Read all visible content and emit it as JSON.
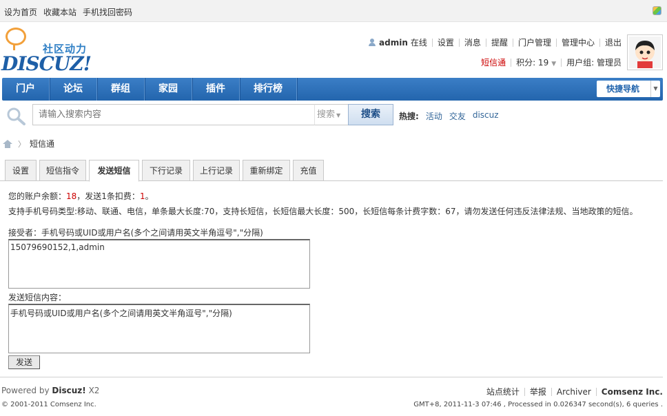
{
  "topbar": {
    "links": [
      "设为首页",
      "收藏本站",
      "手机找回密码"
    ]
  },
  "logo": {
    "cn": "社区动力",
    "en": "DISCUZ!"
  },
  "usernav": {
    "username": "admin",
    "status": "在线",
    "links": [
      "设置",
      "消息",
      "提醒",
      "门户管理",
      "管理中心",
      "退出"
    ]
  },
  "userstat": {
    "sms": "短信通",
    "points_label": "积分: 19",
    "group": "用户组: 管理员"
  },
  "mainnav": {
    "items": [
      "门户",
      "论坛",
      "群组",
      "家园",
      "插件",
      "排行榜"
    ],
    "quicknav": "快捷导航"
  },
  "search": {
    "placeholder": "请输入搜索内容",
    "type": "搜索",
    "button": "搜索",
    "hot_label": "热搜:",
    "hot_words": [
      "活动",
      "交友",
      "discuz"
    ]
  },
  "breadcrumb": {
    "current": "短信通"
  },
  "tabs": [
    "设置",
    "短信指令",
    "发送短信",
    "下行记录",
    "上行记录",
    "重新绑定",
    "充值"
  ],
  "active_tab": "发送短信",
  "info": {
    "balance_prefix": "您的账户余额：",
    "balance": "18",
    "cost_prefix": "，发送1条扣费：",
    "cost": "1",
    "cost_suffix": "。",
    "support": "支持手机号码类型:移动、联通、电信，单条最大长度:70，支持长短信，长短信最大长度：500，长短信每条计费字数：67，请勿发送任何违反法律法规、当地政策的短信。"
  },
  "form": {
    "recipients_label": "接受者：手机号码或UID或用户名(多个之间请用英文半角逗号\",\"分隔)",
    "recipients_value": "15079690152,1,admin",
    "message_label": "发送短信内容：",
    "message_value": "手机号码或UID或用户名(多个之间请用英文半角逗号\",\"分隔)",
    "send_button": "发送"
  },
  "footer": {
    "powered_prefix": "Powered by",
    "powered_brand": "Discuz!",
    "powered_version": "X2",
    "copyright": "© 2001-2011 Comsenz Inc.",
    "links": [
      "站点统计",
      "举报",
      "Archiver"
    ],
    "company": "Comsenz Inc.",
    "debug": "GMT+8, 2011-11-3 07:46 , Processed in 0.026347 second(s), 6 queries ."
  },
  "colors": {
    "nav_blue": "#2365ad",
    "highlight_red": "#cc0000",
    "link_blue": "#336699"
  }
}
